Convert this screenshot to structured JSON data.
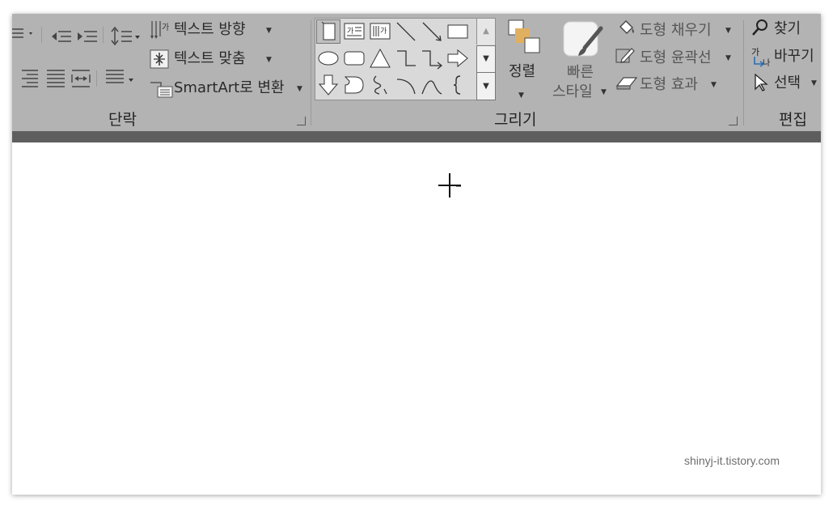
{
  "ribbon": {
    "paragraph": {
      "text_direction_label": "텍스트 방향",
      "align_text_label": "텍스트 맞춤",
      "smartart_label": "SmartArt로 변환",
      "group_label": "단락"
    },
    "drawing": {
      "arrange_label": "정렬",
      "quick_styles_line1": "빠른",
      "quick_styles_line2": "스타일",
      "shape_fill_label": "도형 채우기",
      "shape_outline_label": "도형 윤곽선",
      "shape_effects_label": "도형 효과",
      "group_label": "그리기"
    },
    "editing": {
      "find_label": "찾기",
      "replace_label": "바꾸기",
      "select_label": "선택",
      "group_label": "편집"
    }
  },
  "watermark": "shinyj-it.tistory.com",
  "colors": {
    "ribbon_bg": "#b3b3b3",
    "dark_strip": "#5e5e5e",
    "gallery_bg": "#d9d9d9",
    "arrange_icon_accent": "#e0b060"
  }
}
